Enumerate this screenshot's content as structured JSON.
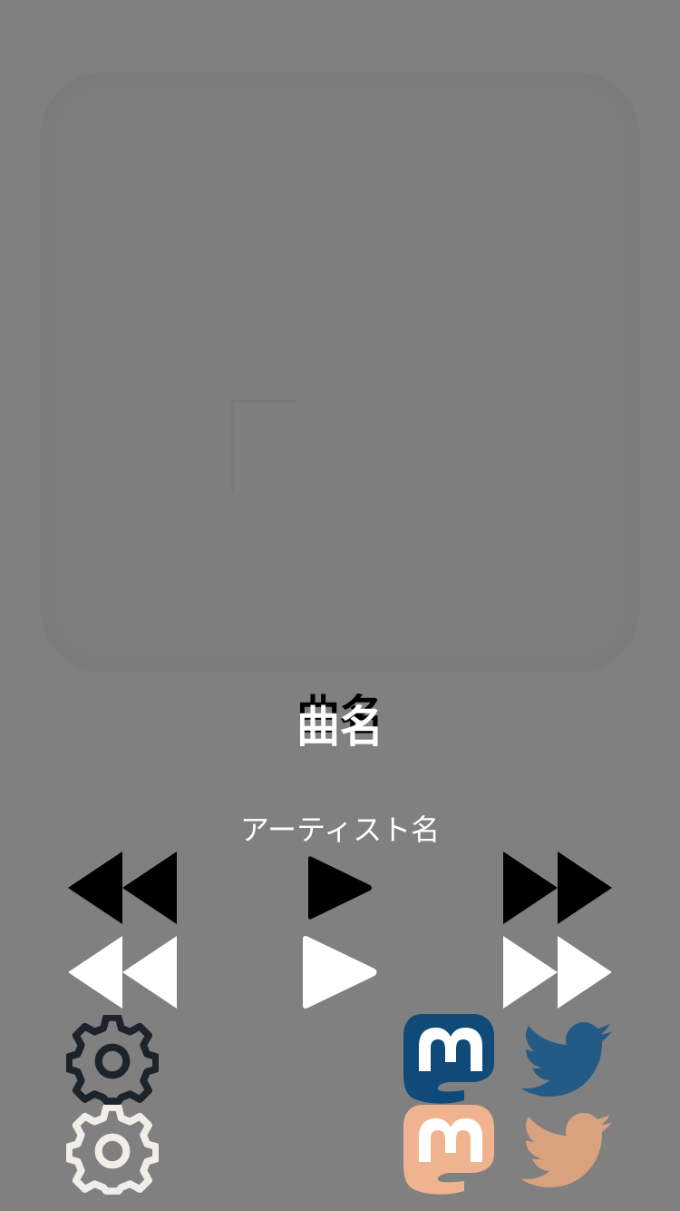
{
  "song": {
    "title": "曲名",
    "artist": "アーティスト名"
  },
  "icons": {
    "rewind": "rewind-icon",
    "play": "play-icon",
    "fast_forward": "fast-forward-icon",
    "settings": "gear-icon",
    "mastodon": "mastodon-icon",
    "twitter": "twitter-icon"
  },
  "colors": {
    "background": "#808080",
    "text_primary": "#ffffff",
    "text_shadow": "#000000",
    "control_dark": "#000000",
    "control_light": "#ffffff",
    "settings_dark": "#1d232b",
    "settings_light": "#f1ede9",
    "mastodon_dark": "#0f4a78",
    "mastodon_light": "#efb38f",
    "twitter_dark": "#245b86",
    "twitter_light": "#d9a27f"
  }
}
